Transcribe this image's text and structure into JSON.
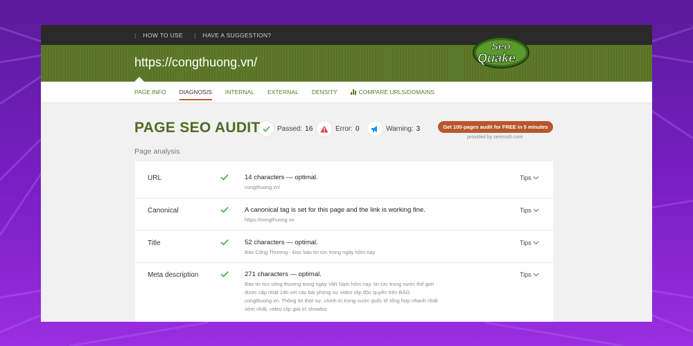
{
  "topbar": {
    "links": [
      "HOW TO USE",
      "HAVE A SUGGESTION?"
    ]
  },
  "header": {
    "url": "https://congthuong.vn/",
    "logo_text": "SeoQuake"
  },
  "tabs": [
    {
      "label": "PAGE INFO",
      "active": false
    },
    {
      "label": "DIAGNOSIS",
      "active": true
    },
    {
      "label": "INTERNAL",
      "active": false
    },
    {
      "label": "EXTERNAL",
      "active": false
    },
    {
      "label": "DENSITY",
      "active": false
    },
    {
      "label": "COMPARE URLS/DOMAINS",
      "active": false,
      "icon": "bar-chart-icon"
    }
  ],
  "audit": {
    "title": "PAGE SEO AUDIT",
    "passed_label": "Passed:",
    "passed_count": "16",
    "error_label": "Error:",
    "error_count": "0",
    "warning_label": "Warning:",
    "warning_count": "3",
    "promo": "Get 100-pages audit for FREE in 5 minutes",
    "provided_by": "provided by  semrush.com"
  },
  "section_label": "Page analysis",
  "rows": [
    {
      "label": "URL",
      "status": "passed",
      "main": "14 characters — optimal.",
      "sub": "congthuong.vn/",
      "tips": "Tips"
    },
    {
      "label": "Canonical",
      "status": "passed",
      "main": "A canonical tag is set for this page and the link is working fine.",
      "sub": "https://congthuong.vn",
      "tips": "Tips"
    },
    {
      "label": "Title",
      "status": "passed",
      "main": "52 characters — optimal.",
      "sub": "Báo Công Thương - Đọc báo tin tức trong ngày hôm nay",
      "tips": "Tips"
    },
    {
      "label": "Meta description",
      "status": "passed",
      "main": "271 characters — optimal.",
      "sub": "Báo tin tức công thương trong ngày Việt Nam hôm nay, tin tức trong nước thế giới được cập nhật 24h với các bài phóng sự video clip độc quyền trên BÁO congthuong.vn. Thông tin thời sự, chính trị trong nước quốc tế tổng hợp nhanh nhất sớm nhất, video clip giải trí showbiz.",
      "tips": "Tips"
    }
  ],
  "colors": {
    "header_green": "#5e7a2a",
    "title_green": "#4f6a22",
    "accent_orange": "#b8562c",
    "check_green": "#4caf50",
    "error_red": "#e53935",
    "warning_blue": "#2196f3"
  }
}
